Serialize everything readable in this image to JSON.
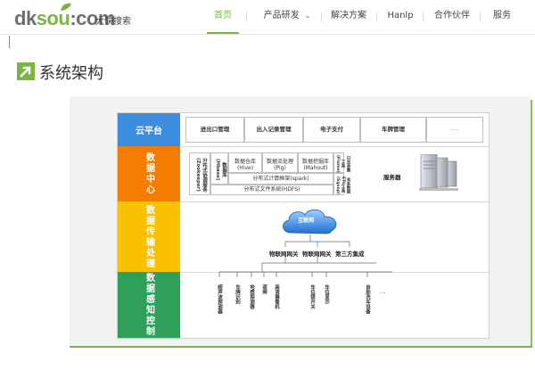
{
  "brand": {
    "logo_prefix": "dk",
    "logo_green": "sou",
    "logo_suffix": ":com",
    "logo_sub": "大快搜索",
    "accent_color": "#7cb342"
  },
  "nav": {
    "items": [
      {
        "label": "首页",
        "active": true
      },
      {
        "label": "产品研发",
        "has_dropdown": true
      },
      {
        "label": "解决方案"
      },
      {
        "label": "Hanlp"
      },
      {
        "label": "合作伙伴"
      },
      {
        "label": "服务"
      }
    ],
    "dropdown_icon": "chevron-down-icon"
  },
  "page": {
    "title": "系统架构",
    "title_icon": "arrow-up-right-icon"
  },
  "diagram": {
    "layers": [
      {
        "name": "云平台",
        "color": "#3c8dde"
      },
      {
        "name": "数据中心",
        "color": "#f57c00"
      },
      {
        "name": "数据传输处理",
        "color": "#f9c100"
      },
      {
        "name": "数据感知控制",
        "color": "#2ea05a"
      }
    ],
    "cloud_platform_items": [
      "进出口管理",
      "出入记录管理",
      "电子支付",
      "车牌管理",
      "……"
    ],
    "data_center": {
      "left_col": "分布式协调服务(Zookeeper)",
      "col2": "实时分布式数据库(Hbase)",
      "modules": [
        "数据仓库(Hive)",
        "数据流处理(Pig)",
        "数据挖掘库(Mahout)"
      ],
      "col_right1": "日志收集工具(Flume)",
      "col_right2": "关系数据ETL工具(Sqoop)",
      "compute": "分布式计算框架(spark)",
      "fs": "分布式文件系统(HDFS)",
      "server_label": "服务器"
    },
    "transport": {
      "cloud_label": "互联网",
      "gateways": [
        "物联网网关",
        "物联网网关",
        "第三方集成"
      ]
    },
    "sensing_items": [
      "超声波探测器",
      "车牌识别",
      "地感探测器",
      "道闸",
      "高清摄像机",
      "车位锁开关",
      "车位显示",
      "自助洗车设备",
      "…"
    ]
  }
}
